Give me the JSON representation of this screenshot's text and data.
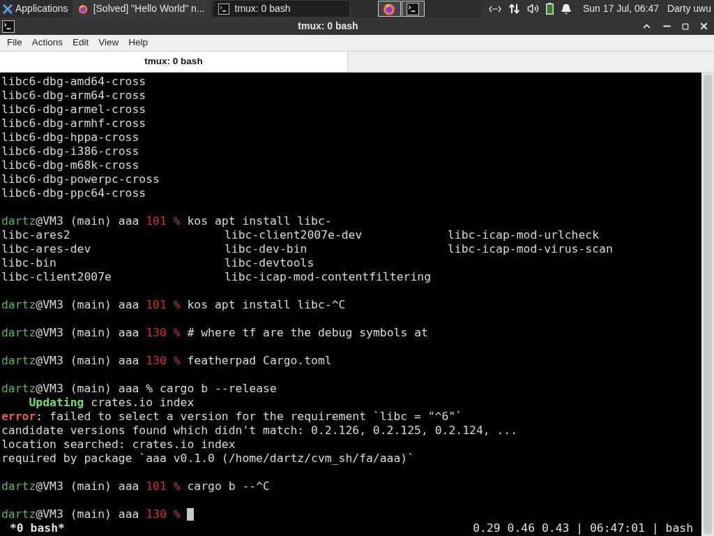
{
  "taskbar": {
    "menu": "Applications",
    "tasks": [
      {
        "kind": "browser",
        "label": "[Solved] \"Hello World\" n...",
        "selected": false
      },
      {
        "kind": "terminal",
        "label": "tmux: 0 bash",
        "selected": true
      }
    ],
    "launchers": [
      {
        "kind": "browser"
      },
      {
        "kind": "terminal"
      }
    ],
    "clock": "Sun 17 Jul, 06:47",
    "user": "Darty uwu"
  },
  "window": {
    "title": "tmux: 0 bash"
  },
  "menu": [
    "File",
    "Actions",
    "Edit",
    "View",
    "Help"
  ],
  "tabs": [
    {
      "label": "tmux: 0 bash",
      "selected": true
    }
  ],
  "terminal": {
    "lines": [
      {
        "kind": "text",
        "text": "libc6-dbg-amd64-cross"
      },
      {
        "kind": "text",
        "text": "libc6-dbg-arm64-cross"
      },
      {
        "kind": "text",
        "text": "libc6-dbg-armel-cross"
      },
      {
        "kind": "text",
        "text": "libc6-dbg-armhf-cross"
      },
      {
        "kind": "text",
        "text": "libc6-dbg-hppa-cross"
      },
      {
        "kind": "text",
        "text": "libc6-dbg-i386-cross"
      },
      {
        "kind": "text",
        "text": "libc6-dbg-m68k-cross"
      },
      {
        "kind": "text",
        "text": "libc6-dbg-powerpc-cross"
      },
      {
        "kind": "text",
        "text": "libc6-dbg-ppc64-cross"
      },
      {
        "kind": "blank"
      },
      {
        "kind": "prompt",
        "user": "dartz",
        "host": "@VM3 (main) aaa",
        "code": "101",
        "symbol": "%",
        "command": "kos apt install libc-"
      },
      {
        "kind": "columns",
        "cells": [
          "libc-ares2",
          "libc-client2007e-dev",
          "libc-icap-mod-urlcheck"
        ]
      },
      {
        "kind": "columns",
        "cells": [
          "libc-ares-dev",
          "libc-dev-bin",
          "libc-icap-mod-virus-scan"
        ]
      },
      {
        "kind": "columns",
        "cells": [
          "libc-bin",
          "libc-devtools"
        ]
      },
      {
        "kind": "columns",
        "cells": [
          "libc-client2007e",
          "libc-icap-mod-contentfiltering"
        ]
      },
      {
        "kind": "blank"
      },
      {
        "kind": "prompt",
        "user": "dartz",
        "host": "@VM3 (main) aaa",
        "code": "101",
        "symbol": "%",
        "command": "kos apt install libc-^C"
      },
      {
        "kind": "blank"
      },
      {
        "kind": "prompt",
        "user": "dartz",
        "host": "@VM3 (main) aaa",
        "code": "130",
        "symbol": "%",
        "command": "# where tf are the debug symbols at"
      },
      {
        "kind": "blank"
      },
      {
        "kind": "prompt",
        "user": "dartz",
        "host": "@VM3 (main) aaa",
        "code": "130",
        "symbol": "%",
        "command": "featherpad Cargo.toml"
      },
      {
        "kind": "blank"
      },
      {
        "kind": "prompt",
        "user": "dartz",
        "host": "@VM3 (main) aaa",
        "symbol": "%",
        "command": "cargo b --release"
      },
      {
        "kind": "status",
        "label": "Updating",
        "text": "crates.io index"
      },
      {
        "kind": "error",
        "label": "error",
        "text": ": failed to select a version for the requirement `libc = \"^6\"`"
      },
      {
        "kind": "text",
        "text": "candidate versions found which didn't match: 0.2.126, 0.2.125, 0.2.124, ..."
      },
      {
        "kind": "text",
        "text": "location searched: crates.io index"
      },
      {
        "kind": "text",
        "text": "required by package `aaa v0.1.0 (/home/dartz/cvm_sh/fa/aaa)`"
      },
      {
        "kind": "blank"
      },
      {
        "kind": "prompt",
        "user": "dartz",
        "host": "@VM3 (main) aaa",
        "code": "101",
        "symbol": "%",
        "command": "cargo b --^C"
      },
      {
        "kind": "blank"
      },
      {
        "kind": "prompt",
        "user": "dartz",
        "host": "@VM3 (main) aaa",
        "code": "130",
        "symbol": "%",
        "cursor": true
      }
    ]
  },
  "status_bar": {
    "window": "*0 bash*",
    "info": "0.29 0.46 0.43 | 06:47:01 | bash"
  }
}
